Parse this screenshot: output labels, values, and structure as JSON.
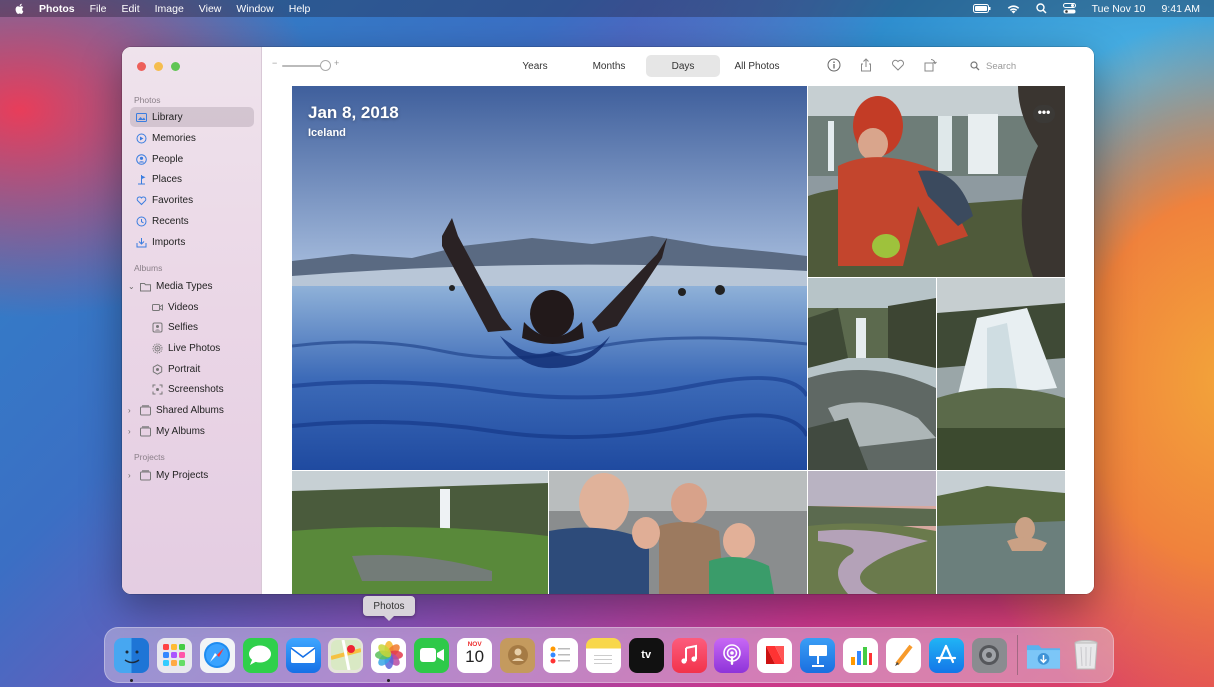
{
  "menubar": {
    "app_name": "Photos",
    "menus": [
      "File",
      "Edit",
      "Image",
      "View",
      "Window",
      "Help"
    ],
    "date": "Tue Nov 10",
    "time": "9:41 AM",
    "status_icons": [
      "battery-icon",
      "wifi-icon",
      "spotlight-search-icon",
      "control-center-icon"
    ]
  },
  "sidebar": {
    "sections": {
      "photos": "Photos",
      "albums": "Albums",
      "projects": "Projects"
    },
    "items": [
      {
        "label": "Library",
        "icon": "library-icon",
        "selected": true
      },
      {
        "label": "Memories",
        "icon": "memories-icon"
      },
      {
        "label": "People",
        "icon": "people-icon"
      },
      {
        "label": "Places",
        "icon": "places-icon"
      },
      {
        "label": "Favorites",
        "icon": "heart-icon"
      },
      {
        "label": "Recents",
        "icon": "clock-icon"
      },
      {
        "label": "Imports",
        "icon": "import-icon"
      }
    ],
    "albums": [
      {
        "label": "Media Types",
        "icon": "folder-icon",
        "expanded": true
      },
      {
        "label": "Videos",
        "icon": "video-icon"
      },
      {
        "label": "Selfies",
        "icon": "selfie-icon"
      },
      {
        "label": "Live Photos",
        "icon": "live-photo-icon"
      },
      {
        "label": "Portrait",
        "icon": "portrait-icon"
      },
      {
        "label": "Screenshots",
        "icon": "screenshot-icon"
      },
      {
        "label": "Shared Albums",
        "icon": "shared-album-icon"
      },
      {
        "label": "My Albums",
        "icon": "album-icon"
      }
    ],
    "projects": [
      {
        "label": "My Projects",
        "icon": "project-icon"
      }
    ]
  },
  "toolbar": {
    "zoom_minus": "−",
    "zoom_plus": "+",
    "zoom_level": 0.85,
    "tabs": [
      "Years",
      "Months",
      "Days",
      "All Photos"
    ],
    "active_tab": "Days",
    "search_placeholder": "Search"
  },
  "grid": {
    "date": "Jan 8, 2018",
    "location": "Iceland",
    "more_label": "•••"
  },
  "tooltip": "Photos",
  "dock": {
    "calendar_month": "NOV",
    "calendar_day": "10",
    "tv_label": "tv",
    "apps": [
      "Finder",
      "Launchpad",
      "Safari",
      "Messages",
      "Mail",
      "Maps",
      "Photos",
      "FaceTime",
      "Calendar",
      "Contacts",
      "Reminders",
      "Notes",
      "TV",
      "Music",
      "Podcasts",
      "News",
      "Keynote",
      "Numbers",
      "Pages",
      "App Store",
      "System Preferences"
    ]
  },
  "colors": {
    "accent": "#3a7de0",
    "traffic_red": "#ed5f5a",
    "traffic_yellow": "#f5bd4f",
    "traffic_green": "#60c554"
  }
}
